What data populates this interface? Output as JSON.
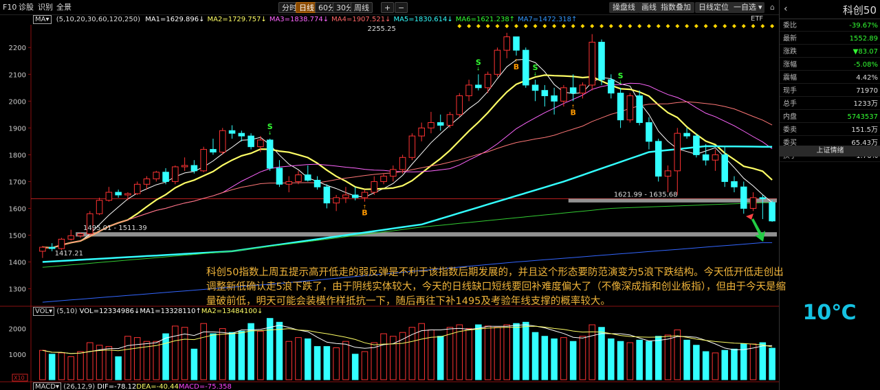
{
  "topbar": {
    "left_items": [
      "F10",
      "诊股",
      "识别",
      "全景"
    ],
    "periods": [
      "分时",
      "日线",
      "60分",
      "30分",
      "周线"
    ],
    "active_period": "日线",
    "zoom_buttons": [
      "+",
      "−"
    ],
    "right_items": [
      "操盘线",
      "画线",
      "指数叠加",
      "日线定位",
      "一自选",
      "▾"
    ],
    "window_icons": [
      "⌂",
      "□"
    ]
  },
  "legend": {
    "ma_box": "MA▾",
    "params": "(5,10,20,30,60,120,250)",
    "items": [
      {
        "text": "MA1=1629.896↓",
        "color": "#ffffff"
      },
      {
        "text": "MA2=1729.757↓",
        "color": "#ffff66"
      },
      {
        "text": "MA3=1838.774↓",
        "color": "#ff66ff"
      },
      {
        "text": "MA4=1907.521↓",
        "color": "#ff6666"
      },
      {
        "text": "MA5=1830.614↓",
        "color": "#33ffff"
      },
      {
        "text": "MA6=1621.238↑",
        "color": "#33ff33"
      },
      {
        "text": "MA7=1472.318↑",
        "color": "#3399ff"
      }
    ],
    "etf": "ETF"
  },
  "vol_legend": {
    "label": "VOL▾",
    "params": "(5,10)",
    "items": [
      {
        "text": "VOL=12334986↓",
        "color": "#ffffff"
      },
      {
        "text": "MA1=13328110↑",
        "color": "#ffffff"
      },
      {
        "text": "MA2=13484100↓",
        "color": "#ffff66"
      }
    ]
  },
  "macd_legend": {
    "label": "MACD▾",
    "params": "(26,12,9)",
    "items": [
      {
        "text": "DIF=-78.12",
        "color": "#ffffff"
      },
      {
        "text": "DEA=-40.44",
        "color": "#ffff66"
      },
      {
        "text": "MACD=-75.358",
        "color": "#ff44ff"
      }
    ]
  },
  "side_panel": {
    "title": "科创50",
    "back": "‹",
    "rows": [
      {
        "k": "委比",
        "v": "-39.67%",
        "color": "#33ff33"
      },
      {
        "k": "最新",
        "v": "1552.89",
        "color": "#33ff33"
      },
      {
        "k": "涨跌",
        "v": "▼83.07",
        "color": "#33ff33"
      },
      {
        "k": "涨幅",
        "v": "-5.08%",
        "color": "#33ff33"
      },
      {
        "k": "震幅",
        "v": "4.42%",
        "color": "#dddddd"
      },
      {
        "k": "现手",
        "v": "71970",
        "color": "#dddddd"
      },
      {
        "k": "总手",
        "v": "1233万",
        "color": "#dddddd"
      },
      {
        "k": "内盘",
        "v": "5743537",
        "color": "#33ff33"
      },
      {
        "k": "委卖",
        "v": "151.5万",
        "color": "#dddddd"
      },
      {
        "k": "委买",
        "v": "65.43万",
        "color": "#dddddd"
      },
      {
        "k": "换手",
        "v": "1.76%",
        "color": "#dddddd"
      }
    ],
    "footer": "上证情绪"
  },
  "temperature": "10℃",
  "annotation": "科创50指数上周五提示高开低走的弱反弹是不利于该指数后期发展的，并且这个形态要防范演变为5浪下跌结构。今天低开低走创出调整新低确认走5浪下跌了，由于阴线实体较大，今天的日线缺口短线要回补难度偏大了（不像深成指和创业板指），但由于今天是缩量破前低，明天可能会装模作样抵抗一下，随后再往下补1495及考验年线支撑的概率较大。",
  "chart_data": {
    "type": "candlestick",
    "y_ticks": [
      1300,
      1400,
      1500,
      1600,
      1700,
      1800,
      1900,
      2000,
      2100,
      2200
    ],
    "ylim": [
      1240,
      2280
    ],
    "vol_ticks": [
      "2000",
      "1000"
    ],
    "vol_unit": "X10",
    "vol_max": 2500,
    "price_labels": [
      {
        "text": "2255.25",
        "x": 34,
        "y": 2255
      },
      {
        "text": "1495.01 - 1511.39",
        "x": 4,
        "y": 1511
      },
      {
        "text": "1417.21",
        "x": 1,
        "y": 1417
      },
      {
        "text": "1621.99 - 1635.68",
        "x": 60,
        "y": 1636
      }
    ],
    "support_bands": [
      {
        "name": "1495-1511",
        "from": 1495,
        "to": 1511,
        "x_start": 4
      },
      {
        "name": "1622-1636",
        "from": 1622,
        "to": 1636,
        "x_start": 56
      }
    ],
    "resistance_line": 1636,
    "signals": [
      {
        "type": "S",
        "x": 24
      },
      {
        "type": "B",
        "x": 34
      },
      {
        "type": "S",
        "x": 46
      },
      {
        "type": "B",
        "x": 50
      },
      {
        "type": "S",
        "x": 52
      },
      {
        "type": "B",
        "x": 56
      },
      {
        "type": "S",
        "x": 61
      }
    ],
    "candles": [
      {
        "o": 1440,
        "h": 1460,
        "l": 1415,
        "c": 1455,
        "v": 1150
      },
      {
        "o": 1455,
        "h": 1470,
        "l": 1440,
        "c": 1450,
        "v": 1000
      },
      {
        "o": 1450,
        "h": 1490,
        "l": 1445,
        "c": 1485,
        "v": 1050
      },
      {
        "o": 1485,
        "h": 1520,
        "l": 1480,
        "c": 1498,
        "v": 900
      },
      {
        "o": 1498,
        "h": 1510,
        "l": 1490,
        "c": 1505,
        "v": 1100
      },
      {
        "o": 1505,
        "h": 1590,
        "l": 1500,
        "c": 1580,
        "v": 1450
      },
      {
        "o": 1580,
        "h": 1640,
        "l": 1575,
        "c": 1630,
        "v": 1350
      },
      {
        "o": 1630,
        "h": 1680,
        "l": 1625,
        "c": 1660,
        "v": 1300
      },
      {
        "o": 1660,
        "h": 1670,
        "l": 1640,
        "c": 1650,
        "v": 900
      },
      {
        "o": 1650,
        "h": 1660,
        "l": 1630,
        "c": 1655,
        "v": 1700
      },
      {
        "o": 1655,
        "h": 1700,
        "l": 1650,
        "c": 1690,
        "v": 1650
      },
      {
        "o": 1690,
        "h": 1720,
        "l": 1670,
        "c": 1710,
        "v": 1500
      },
      {
        "o": 1710,
        "h": 1740,
        "l": 1700,
        "c": 1735,
        "v": 1500
      },
      {
        "o": 1735,
        "h": 1750,
        "l": 1690,
        "c": 1700,
        "v": 1800
      },
      {
        "o": 1700,
        "h": 1760,
        "l": 1690,
        "c": 1755,
        "v": 2100
      },
      {
        "o": 1755,
        "h": 1790,
        "l": 1740,
        "c": 1760,
        "v": 2050
      },
      {
        "o": 1760,
        "h": 1780,
        "l": 1730,
        "c": 1740,
        "v": 1200
      },
      {
        "o": 1740,
        "h": 1830,
        "l": 1735,
        "c": 1820,
        "v": 2200
      },
      {
        "o": 1820,
        "h": 1860,
        "l": 1800,
        "c": 1810,
        "v": 1800
      },
      {
        "o": 1810,
        "h": 1900,
        "l": 1800,
        "c": 1890,
        "v": 2000
      },
      {
        "o": 1890,
        "h": 1910,
        "l": 1860,
        "c": 1880,
        "v": 1850
      },
      {
        "o": 1880,
        "h": 1890,
        "l": 1850,
        "c": 1870,
        "v": 1900
      },
      {
        "o": 1870,
        "h": 1880,
        "l": 1820,
        "c": 1830,
        "v": 2200
      },
      {
        "o": 1830,
        "h": 1870,
        "l": 1810,
        "c": 1855,
        "v": 1900
      },
      {
        "o": 1855,
        "h": 1860,
        "l": 1740,
        "c": 1750,
        "v": 2400
      },
      {
        "o": 1750,
        "h": 1780,
        "l": 1680,
        "c": 1690,
        "v": 2250
      },
      {
        "o": 1690,
        "h": 1720,
        "l": 1660,
        "c": 1700,
        "v": 1500
      },
      {
        "o": 1700,
        "h": 1740,
        "l": 1690,
        "c": 1725,
        "v": 1650
      },
      {
        "o": 1725,
        "h": 1760,
        "l": 1700,
        "c": 1705,
        "v": 1600
      },
      {
        "o": 1705,
        "h": 1720,
        "l": 1670,
        "c": 1680,
        "v": 1300
      },
      {
        "o": 1680,
        "h": 1690,
        "l": 1600,
        "c": 1620,
        "v": 1300
      },
      {
        "o": 1620,
        "h": 1650,
        "l": 1590,
        "c": 1640,
        "v": 1250
      },
      {
        "o": 1640,
        "h": 1680,
        "l": 1620,
        "c": 1650,
        "v": 1500
      },
      {
        "o": 1650,
        "h": 1680,
        "l": 1630,
        "c": 1640,
        "v": 1000
      },
      {
        "o": 1640,
        "h": 1670,
        "l": 1625,
        "c": 1660,
        "v": 1100
      },
      {
        "o": 1660,
        "h": 1720,
        "l": 1650,
        "c": 1700,
        "v": 1450
      },
      {
        "o": 1700,
        "h": 1730,
        "l": 1690,
        "c": 1720,
        "v": 1800
      },
      {
        "o": 1720,
        "h": 1760,
        "l": 1700,
        "c": 1745,
        "v": 1700
      },
      {
        "o": 1745,
        "h": 1800,
        "l": 1730,
        "c": 1790,
        "v": 1850
      },
      {
        "o": 1790,
        "h": 1880,
        "l": 1780,
        "c": 1870,
        "v": 2050
      },
      {
        "o": 1870,
        "h": 1920,
        "l": 1850,
        "c": 1900,
        "v": 2200
      },
      {
        "o": 1900,
        "h": 1960,
        "l": 1880,
        "c": 1920,
        "v": 1950
      },
      {
        "o": 1920,
        "h": 1950,
        "l": 1890,
        "c": 1910,
        "v": 1700
      },
      {
        "o": 1910,
        "h": 1960,
        "l": 1900,
        "c": 1950,
        "v": 2050
      },
      {
        "o": 1950,
        "h": 2030,
        "l": 1940,
        "c": 2020,
        "v": 2150
      },
      {
        "o": 2020,
        "h": 2080,
        "l": 2000,
        "c": 2060,
        "v": 2000
      },
      {
        "o": 2060,
        "h": 2100,
        "l": 2040,
        "c": 2050,
        "v": 2150
      },
      {
        "o": 2050,
        "h": 2110,
        "l": 2030,
        "c": 2100,
        "v": 2100
      },
      {
        "o": 2100,
        "h": 2200,
        "l": 2090,
        "c": 2190,
        "v": 2050
      },
      {
        "o": 2190,
        "h": 2255,
        "l": 2160,
        "c": 2240,
        "v": 2150
      },
      {
        "o": 2240,
        "h": 2240,
        "l": 2170,
        "c": 2190,
        "v": 2200
      },
      {
        "o": 2190,
        "h": 2200,
        "l": 2050,
        "c": 2060,
        "v": 2250
      },
      {
        "o": 2060,
        "h": 2080,
        "l": 2000,
        "c": 2040,
        "v": 1850
      },
      {
        "o": 2040,
        "h": 2060,
        "l": 1980,
        "c": 2020,
        "v": 1700
      },
      {
        "o": 2020,
        "h": 2050,
        "l": 1950,
        "c": 2000,
        "v": 1600
      },
      {
        "o": 2000,
        "h": 2060,
        "l": 1980,
        "c": 2050,
        "v": 1650
      },
      {
        "o": 2050,
        "h": 2100,
        "l": 2000,
        "c": 2030,
        "v": 1500
      },
      {
        "o": 2030,
        "h": 2070,
        "l": 2010,
        "c": 2060,
        "v": 1700
      },
      {
        "o": 2060,
        "h": 2250,
        "l": 2040,
        "c": 2220,
        "v": 2150
      },
      {
        "o": 2220,
        "h": 2230,
        "l": 2060,
        "c": 2080,
        "v": 2050
      },
      {
        "o": 2080,
        "h": 2100,
        "l": 2010,
        "c": 2030,
        "v": 1600
      },
      {
        "o": 2030,
        "h": 2050,
        "l": 1900,
        "c": 1930,
        "v": 1500
      },
      {
        "o": 1930,
        "h": 2030,
        "l": 1920,
        "c": 2020,
        "v": 1450
      },
      {
        "o": 2020,
        "h": 2040,
        "l": 1910,
        "c": 1920,
        "v": 1550
      },
      {
        "o": 1920,
        "h": 1940,
        "l": 1820,
        "c": 1850,
        "v": 1500
      },
      {
        "o": 1850,
        "h": 1860,
        "l": 1700,
        "c": 1720,
        "v": 1700
      },
      {
        "o": 1720,
        "h": 1760,
        "l": 1660,
        "c": 1740,
        "v": 1750
      },
      {
        "o": 1740,
        "h": 1900,
        "l": 1650,
        "c": 1880,
        "v": 1950
      },
      {
        "o": 1880,
        "h": 1900,
        "l": 1860,
        "c": 1870,
        "v": 1550
      },
      {
        "o": 1870,
        "h": 1880,
        "l": 1790,
        "c": 1800,
        "v": 1350
      },
      {
        "o": 1800,
        "h": 1840,
        "l": 1760,
        "c": 1780,
        "v": 1100
      },
      {
        "o": 1780,
        "h": 1820,
        "l": 1740,
        "c": 1800,
        "v": 1050
      },
      {
        "o": 1800,
        "h": 1830,
        "l": 1680,
        "c": 1700,
        "v": 1150
      },
      {
        "o": 1700,
        "h": 1720,
        "l": 1660,
        "c": 1680,
        "v": 1200
      },
      {
        "o": 1680,
        "h": 1700,
        "l": 1580,
        "c": 1600,
        "v": 1400
      },
      {
        "o": 1600,
        "h": 1660,
        "l": 1590,
        "c": 1640,
        "v": 1400
      },
      {
        "o": 1640,
        "h": 1650,
        "l": 1560,
        "c": 1636,
        "v": 1450
      },
      {
        "o": 1622,
        "h": 1630,
        "l": 1550,
        "c": 1553,
        "v": 1233
      }
    ],
    "ma_lines": [
      {
        "name": "MA1",
        "color": "#ffffff",
        "width": 1,
        "period": 5
      },
      {
        "name": "MA2",
        "color": "#ffff66",
        "width": 2.2,
        "period": 10
      },
      {
        "name": "MA3",
        "color": "#ff66ff",
        "width": 1,
        "period": 20
      },
      {
        "name": "MA4",
        "color": "#ff7777",
        "width": 1,
        "period": 30
      },
      {
        "name": "MA5",
        "color": "#33ffff",
        "width": 2.5,
        "anchors": [
          [
            0,
            1400
          ],
          [
            20,
            1440
          ],
          [
            40,
            1540
          ],
          [
            55,
            1700
          ],
          [
            64,
            1810
          ],
          [
            70,
            1832
          ],
          [
            76,
            1830
          ]
        ]
      },
      {
        "name": "MA6",
        "color": "#33cc33",
        "width": 1,
        "anchors": [
          [
            0,
            1380
          ],
          [
            20,
            1440
          ],
          [
            40,
            1530
          ],
          [
            60,
            1600
          ],
          [
            76,
            1621
          ]
        ]
      },
      {
        "name": "MA7",
        "color": "#3366ff",
        "width": 1,
        "anchors": [
          [
            0,
            1250
          ],
          [
            25,
            1320
          ],
          [
            50,
            1400
          ],
          [
            76,
            1472
          ]
        ]
      }
    ],
    "vol_lines": [
      {
        "name": "VOL-MA1",
        "color": "#ffffff",
        "period": 5
      },
      {
        "name": "VOL-MA2",
        "color": "#ffff66",
        "period": 10
      }
    ]
  }
}
